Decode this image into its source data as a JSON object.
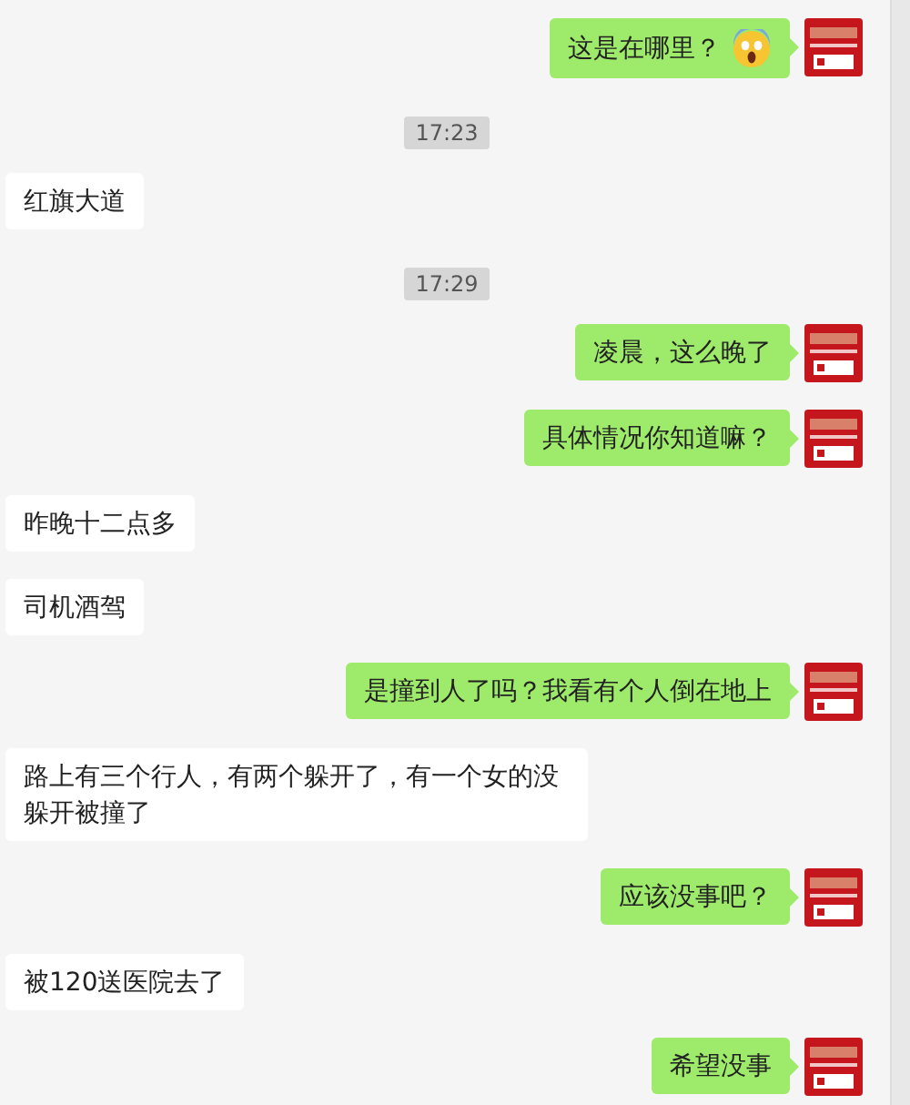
{
  "messages": [
    {
      "kind": "sent",
      "text": "这是在哪里？",
      "emoji": true
    },
    {
      "kind": "time",
      "text": "17:23"
    },
    {
      "kind": "received",
      "text": "红旗大道"
    },
    {
      "kind": "time",
      "text": "17:29"
    },
    {
      "kind": "sent",
      "text": "凌晨，这么晚了"
    },
    {
      "kind": "sent",
      "text": "具体情况你知道嘛？"
    },
    {
      "kind": "received",
      "text": "昨晚十二点多"
    },
    {
      "kind": "received",
      "text": "司机酒驾"
    },
    {
      "kind": "sent",
      "text": "是撞到人了吗？我看有个人倒在地上"
    },
    {
      "kind": "received",
      "text": "路上有三个行人，有两个躲开了，有一个女的没躲开被撞了"
    },
    {
      "kind": "sent",
      "text": "应该没事吧？"
    },
    {
      "kind": "received",
      "text": "被120送医院去了"
    },
    {
      "kind": "sent",
      "text": "希望没事"
    }
  ]
}
